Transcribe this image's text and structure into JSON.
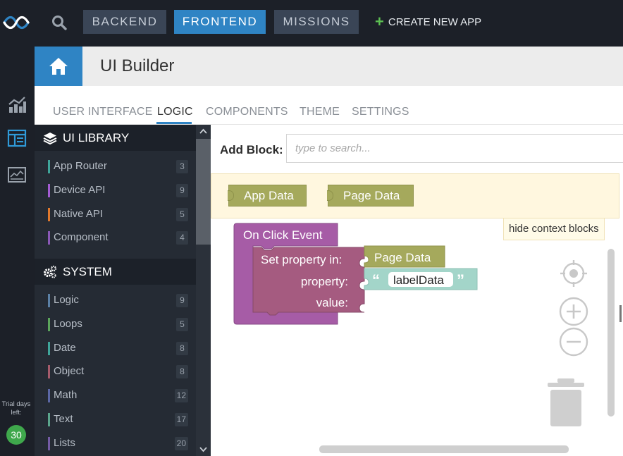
{
  "topbar": {
    "buttons": {
      "backend": "BACKEND",
      "frontend": "FRONTEND",
      "missions": "MISSIONS"
    },
    "create_app": "CREATE NEW APP",
    "colors": {
      "active": "#2f84c4",
      "inactive": "#3a4556",
      "plus": "#5cbf52"
    }
  },
  "header": {
    "title": "UI Builder"
  },
  "tabs": [
    {
      "label": "USER INTERFACE",
      "active": false
    },
    {
      "label": "LOGIC",
      "active": true
    },
    {
      "label": "COMPONENTS",
      "active": false
    },
    {
      "label": "THEME",
      "active": false
    },
    {
      "label": "SETTINGS",
      "active": false
    }
  ],
  "library": {
    "ui_library": {
      "title": "UI LIBRARY",
      "icon": "layers-icon",
      "items": [
        {
          "label": "App Router",
          "count": "3",
          "color": "#3fa59a"
        },
        {
          "label": "Device API",
          "count": "9",
          "color": "#a35cd3"
        },
        {
          "label": "Native API",
          "count": "5",
          "color": "#e0782c"
        },
        {
          "label": "Component",
          "count": "4",
          "color": "#8a58b6"
        }
      ]
    },
    "system": {
      "title": "SYSTEM",
      "icon": "gears-icon",
      "items": [
        {
          "label": "Logic",
          "count": "9",
          "color": "#5b80a5"
        },
        {
          "label": "Loops",
          "count": "5",
          "color": "#5ba55b"
        },
        {
          "label": "Date",
          "count": "8",
          "color": "#3fa59a"
        },
        {
          "label": "Object",
          "count": "8",
          "color": "#a55b6b"
        },
        {
          "label": "Math",
          "count": "12",
          "color": "#5b67a5"
        },
        {
          "label": "Text",
          "count": "17",
          "color": "#5ba58c"
        },
        {
          "label": "Lists",
          "count": "20",
          "color": "#745ba5"
        }
      ]
    }
  },
  "workspace": {
    "add_block_label": "Add Block:",
    "search_placeholder": "type to search...",
    "context_blocks": [
      "App Data",
      "Page Data"
    ],
    "hide_context": "hide context blocks",
    "blocks": {
      "event": "On Click Event",
      "set_property_in": "Set property in:",
      "target": "Page Data",
      "property_label": "property:",
      "property_value": "labelData",
      "value_label": "value:"
    },
    "colors": {
      "event": "#a65ca6",
      "set": "#a55b80",
      "data": "#a5a95c",
      "text": "#a3d5c9"
    }
  },
  "trial": {
    "label": "Trial days left:",
    "days": "30"
  }
}
